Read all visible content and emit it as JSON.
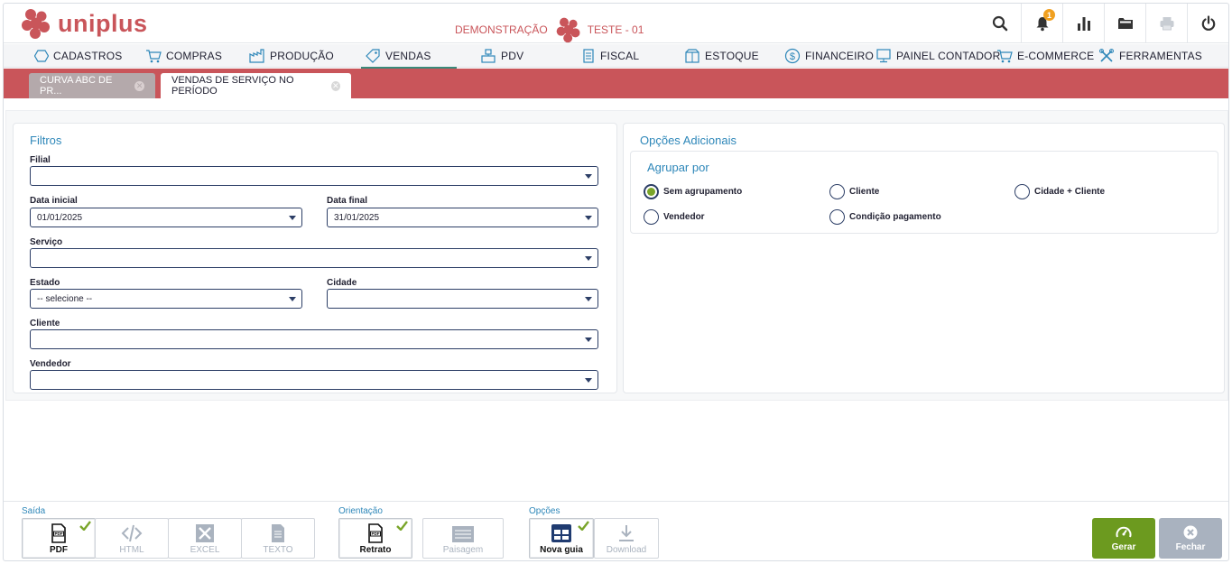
{
  "header": {
    "brand": "uniplus",
    "environment": "DEMONSTRAÇÃO",
    "company": "TESTE - 01",
    "notification_count": "1",
    "icons": [
      "search-icon",
      "bell-icon",
      "bar-chart-icon",
      "folder-icon",
      "printer-icon",
      "power-icon"
    ],
    "brand_color": "#c9555a"
  },
  "menu": {
    "items": [
      {
        "label": "CADASTROS",
        "icon": "hexagon-icon"
      },
      {
        "label": "COMPRAS",
        "icon": "cart-icon"
      },
      {
        "label": "PRODUÇÃO",
        "icon": "factory-icon"
      },
      {
        "label": "VENDAS",
        "icon": "tag-icon"
      },
      {
        "label": "PDV",
        "icon": "register-icon"
      },
      {
        "label": "FISCAL",
        "icon": "document-icon"
      },
      {
        "label": "ESTOQUE",
        "icon": "box-icon"
      },
      {
        "label": "FINANCEIRO",
        "icon": "dollar-icon"
      },
      {
        "label": "PAINEL CONTADOR",
        "icon": "monitor-icon"
      },
      {
        "label": "E-COMMERCE",
        "icon": "cart-icon"
      },
      {
        "label": "FERRAMENTAS",
        "icon": "tools-icon"
      }
    ],
    "active": "VENDAS"
  },
  "tabs": [
    {
      "label": "CURVA ABC DE PR...",
      "active": false
    },
    {
      "label": "VENDAS DE SERVIÇO NO PERÍODO",
      "active": true
    }
  ],
  "filters": {
    "title": "Filtros",
    "filial_label": "Filial",
    "filial_value": "",
    "data_inicial_label": "Data inicial",
    "data_inicial_value": "01/01/2025",
    "data_final_label": "Data final",
    "data_final_value": "31/01/2025",
    "servico_label": "Serviço",
    "servico_value": "",
    "estado_label": "Estado",
    "estado_value": "-- selecione --",
    "cidade_label": "Cidade",
    "cidade_value": "",
    "cliente_label": "Cliente",
    "cliente_value": "",
    "vendedor_label": "Vendedor",
    "vendedor_value": ""
  },
  "options": {
    "title": "Opções Adicionais",
    "group_title": "Agrupar por",
    "radios": [
      {
        "label": "Sem agrupamento",
        "checked": true
      },
      {
        "label": "Cliente",
        "checked": false
      },
      {
        "label": "Cidade + Cliente",
        "checked": false
      },
      {
        "label": "Vendedor",
        "checked": false
      },
      {
        "label": "Condição pagamento",
        "checked": false
      }
    ]
  },
  "toolbar": {
    "saida_label": "Saída",
    "orientacao_label": "Orientação",
    "opcoes_label": "Opções",
    "saida": [
      {
        "label": "PDF",
        "enabled": true,
        "checked": true
      },
      {
        "label": "HTML",
        "enabled": false
      },
      {
        "label": "EXCEL",
        "enabled": false
      },
      {
        "label": "TEXTO",
        "enabled": false
      }
    ],
    "orientacao": [
      {
        "label": "Retrato",
        "enabled": true,
        "checked": true
      },
      {
        "label": "Paisagem",
        "enabled": false
      }
    ],
    "opcoes": [
      {
        "label": "Nova guia",
        "enabled": true,
        "checked": true
      },
      {
        "label": "Download",
        "enabled": false
      }
    ],
    "gerar_label": "Gerar",
    "fechar_label": "Fechar",
    "gerar_color": "#6c9a1f",
    "fechar_color": "#a9b2bf"
  }
}
